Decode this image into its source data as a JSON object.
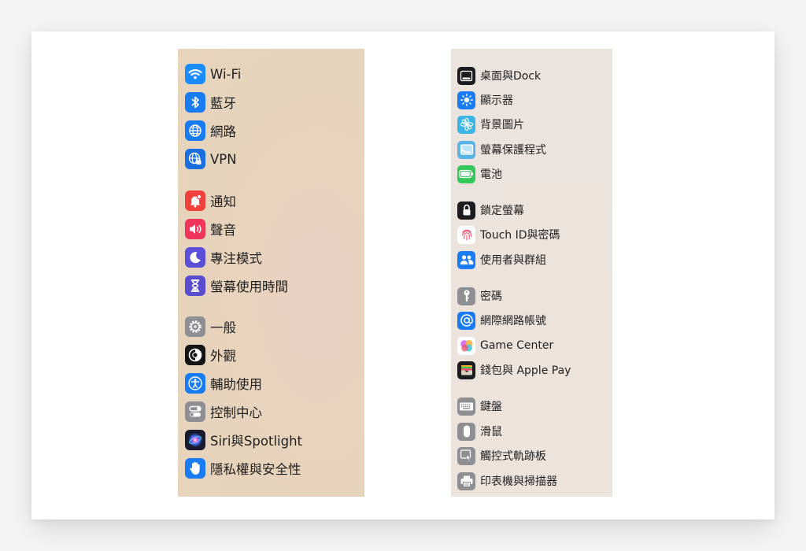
{
  "left_panel": {
    "items": [
      {
        "label": "Wi-Fi",
        "icon": "wifi-icon",
        "color": "#1a8cff"
      },
      {
        "label": "藍牙",
        "icon": "bluetooth-icon",
        "color": "#1a7cf5"
      },
      {
        "label": "網路",
        "icon": "globe-icon",
        "color": "#1a7cf5"
      },
      {
        "label": "VPN",
        "icon": "vpn-globe-icon",
        "color": "#1a6fe0"
      },
      {
        "label": "通知",
        "icon": "notification-bell-icon",
        "color": "#f2403c"
      },
      {
        "label": "聲音",
        "icon": "speaker-icon",
        "color": "#f0355a"
      },
      {
        "label": "專注模式",
        "icon": "moon-icon",
        "color": "#5b4fd8"
      },
      {
        "label": "螢幕使用時間",
        "icon": "hourglass-icon",
        "color": "#5a4ccf"
      },
      {
        "label": "一般",
        "icon": "gear-icon",
        "color": "#8e8e93"
      },
      {
        "label": "外觀",
        "icon": "appearance-icon",
        "color": "#141414"
      },
      {
        "label": "輔助使用",
        "icon": "accessibility-icon",
        "color": "#1a7cf5"
      },
      {
        "label": "控制中心",
        "icon": "control-center-icon",
        "color": "#8e8e93"
      },
      {
        "label": "Siri與Spotlight",
        "icon": "siri-icon",
        "color": "#2b2b5e"
      },
      {
        "label": "隱私權與安全性",
        "icon": "hand-icon",
        "color": "#1a7cf5"
      }
    ]
  },
  "right_panel": {
    "items": [
      {
        "label": "桌面與Dock",
        "icon": "dock-icon",
        "color": "#1c1c1e"
      },
      {
        "label": "顯示器",
        "icon": "display-sun-icon",
        "color": "#1a7cf5"
      },
      {
        "label": "背景圖片",
        "icon": "wallpaper-flower-icon",
        "color": "#3bb4e6"
      },
      {
        "label": "螢幕保護程式",
        "icon": "screensaver-icon",
        "color": "#5ab4e8"
      },
      {
        "label": "電池",
        "icon": "battery-icon",
        "color": "#34c759"
      },
      {
        "label": "鎖定螢幕",
        "icon": "lock-icon",
        "color": "#1c1c1e"
      },
      {
        "label": "Touch ID與密碼",
        "icon": "fingerprint-icon",
        "color": "#ffffff"
      },
      {
        "label": "使用者與群組",
        "icon": "users-icon",
        "color": "#1a7cf5"
      },
      {
        "label": "密碼",
        "icon": "key-icon",
        "color": "#8e8e93"
      },
      {
        "label": "網際網路帳號",
        "icon": "at-sign-icon",
        "color": "#1a7cf5"
      },
      {
        "label": "Game Center",
        "icon": "game-center-icon",
        "color": "#ffffff"
      },
      {
        "label": "錢包與 Apple Pay",
        "icon": "wallet-icon",
        "color": "#1c1c1e"
      },
      {
        "label": "鍵盤",
        "icon": "keyboard-icon",
        "color": "#8e8e93"
      },
      {
        "label": "滑鼠",
        "icon": "mouse-icon",
        "color": "#8e8e93"
      },
      {
        "label": "觸控式軌跡板",
        "icon": "trackpad-icon",
        "color": "#8e8e93"
      },
      {
        "label": "印表機與掃描器",
        "icon": "printer-icon",
        "color": "#8e8e93"
      }
    ]
  }
}
